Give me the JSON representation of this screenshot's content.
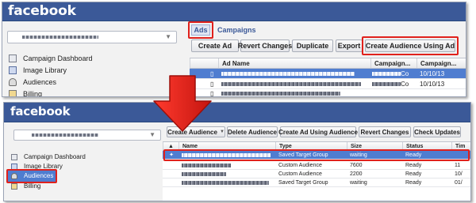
{
  "brand": {
    "logo_text": "facebook",
    "bar_color": "#3b5998"
  },
  "top_screen": {
    "sidebar": {
      "items": [
        {
          "label": "Campaign Dashboard",
          "icon": "dashboard-icon"
        },
        {
          "label": "Image Library",
          "icon": "image-library-icon"
        },
        {
          "label": "Audiences",
          "icon": "audiences-icon"
        },
        {
          "label": "Billing",
          "icon": "billing-icon"
        }
      ]
    },
    "breadcrumb": {
      "ads": "Ads",
      "campaigns": "Campaigns"
    },
    "toolbar": {
      "create_ad": "Create Ad",
      "revert_changes": "Revert Changes",
      "duplicate": "Duplicate",
      "export": "Export",
      "create_audience_using_ad": "Create Audience Using Ad"
    },
    "table": {
      "columns": [
        "Ad Name",
        "Campaign...",
        "Campaign..."
      ],
      "rows": [
        {
          "suffix": "Co",
          "date": "10/10/13",
          "selected": true
        },
        {
          "suffix": "Co",
          "date": "10/10/13",
          "selected": false
        },
        {
          "suffix": "",
          "date": "",
          "selected": false
        }
      ]
    }
  },
  "bottom_screen": {
    "sidebar": {
      "items": [
        {
          "label": "Campaign Dashboard",
          "icon": "dashboard-icon"
        },
        {
          "label": "Image Library",
          "icon": "image-library-icon"
        },
        {
          "label": "Audiences",
          "icon": "audiences-icon",
          "selected": true
        },
        {
          "label": "Billing",
          "icon": "billing-icon"
        }
      ]
    },
    "toolbar": {
      "create_audience": "Create Audience",
      "delete_audience": "Delete Audience",
      "create_ad_using_audience": "Create Ad Using Audience",
      "revert_changes": "Revert Changes",
      "check_updates": "Check Updates"
    },
    "table": {
      "columns": [
        "Name",
        "Type",
        "Size",
        "Status",
        "Tim"
      ],
      "rows": [
        {
          "type": "Saved Target Group",
          "size": "waiting",
          "status": "Ready",
          "time": "",
          "selected": true
        },
        {
          "type": "Custom Audience",
          "size": "7600",
          "status": "Ready",
          "time": "11",
          "selected": false
        },
        {
          "type": "Custom Audience",
          "size": "2200",
          "status": "Ready",
          "time": "10/",
          "selected": false
        },
        {
          "type": "Saved Target Group",
          "size": "waiting",
          "status": "Ready",
          "time": "01/",
          "selected": false
        }
      ]
    }
  },
  "annotation_color": "#e0211c"
}
